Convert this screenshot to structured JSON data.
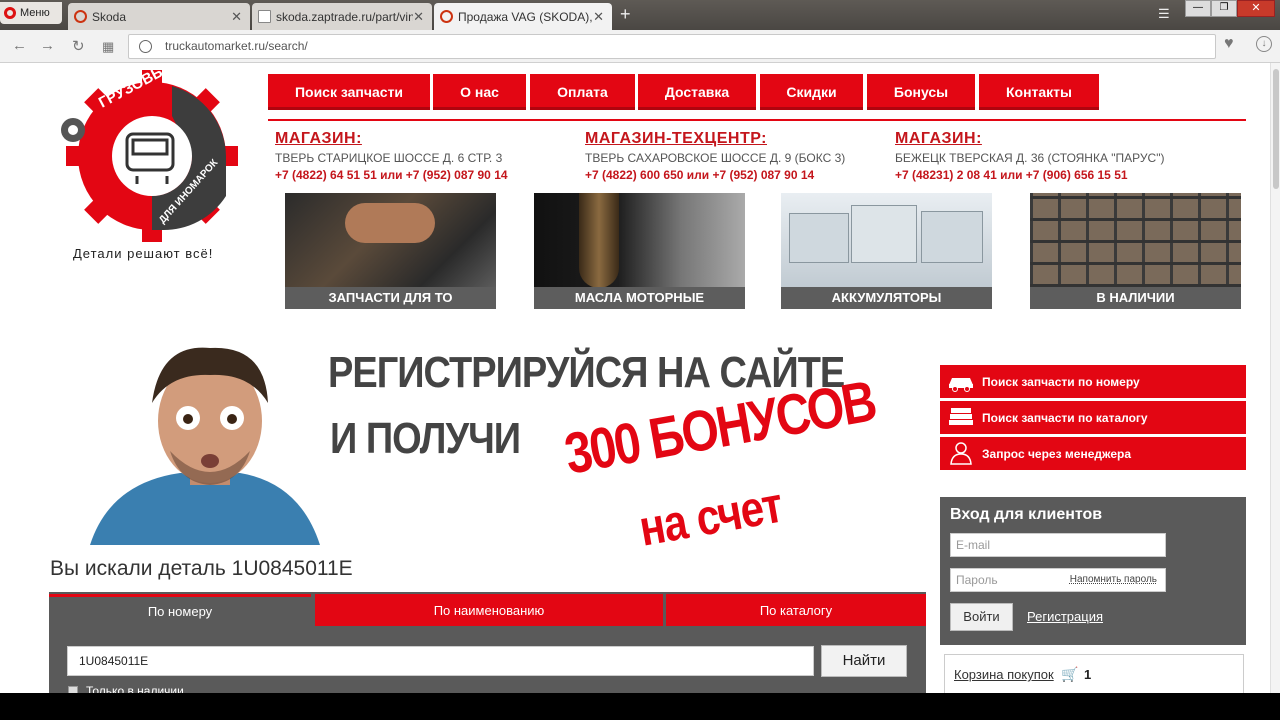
{
  "browser": {
    "menu_label": "Меню",
    "tabs": [
      {
        "title": "Skoda"
      },
      {
        "title": "skoda.zaptrade.ru/part/vin"
      },
      {
        "title": "Продажа VAG (SKODA), б"
      }
    ],
    "url": "truckautomarket.ru/search/"
  },
  "logo": {
    "arc_text": "ГРУЗОВЫЕ ЗАПЧАСТИ",
    "sub_text": "ДЛЯ ИНОМАРОК",
    "tagline": "Детали решают всё!"
  },
  "nav": {
    "items": [
      {
        "label": "Поиск запчасти"
      },
      {
        "label": "О нас"
      },
      {
        "label": "Оплата"
      },
      {
        "label": "Доставка"
      },
      {
        "label": "Скидки"
      },
      {
        "label": "Бонусы"
      },
      {
        "label": "Контакты"
      }
    ]
  },
  "stores": [
    {
      "title": "МАГАЗИН:",
      "address": "ТВЕРЬ СТАРИЦКОЕ ШОССЕ Д. 6 СТР. 3",
      "phone": "+7 (4822) 64 51 51 или +7 (952) 087 90 14"
    },
    {
      "title": "МАГАЗИН-ТЕХЦЕНТР:",
      "address": "ТВЕРЬ САХАРОВСКОЕ ШОССЕ Д. 9 (БОКС 3)",
      "phone": "+7 (4822) 600 650 или +7 (952) 087 90 14"
    },
    {
      "title": "МАГАЗИН:",
      "address": "БЕЖЕЦК ТВЕРСКАЯ Д. 36 (СТОЯНКА \"ПАРУС\")",
      "phone": "+7 (48231) 2 08 41 или +7 (906) 656 15 51"
    }
  ],
  "categories": [
    {
      "label": "ЗАПЧАСТИ ДЛЯ ТО"
    },
    {
      "label": "МАСЛА МОТОРНЫЕ"
    },
    {
      "label": "АККУМУЛЯТОРЫ"
    },
    {
      "label": "В НАЛИЧИИ"
    }
  ],
  "banner": {
    "line1": "РЕГИСТРИРУЙСЯ НА САЙТЕ",
    "line2": "И ПОЛУЧИ",
    "bonus1": "300 БОНУСОВ",
    "bonus2": "на счет"
  },
  "sidebar": {
    "buttons": [
      {
        "label": "Поиск запчасти по номеру",
        "icon": "car-icon"
      },
      {
        "label": "Поиск запчасти по каталогу",
        "icon": "books-icon"
      },
      {
        "label": "Запрос через менеджера",
        "icon": "manager-icon"
      }
    ],
    "login": {
      "title": "Вход для клиентов",
      "email_placeholder": "E-mail",
      "password_placeholder": "Пароль",
      "remind": "Напомнить пароль",
      "submit": "Войти",
      "register": "Регистрация"
    },
    "cart": {
      "label": "Корзина покупок",
      "count": "1"
    }
  },
  "search": {
    "heading": "Вы искали деталь 1U0845011E",
    "tabs": [
      {
        "label": "По номеру"
      },
      {
        "label": "По наименованию"
      },
      {
        "label": "По каталогу"
      }
    ],
    "value": "1U0845011E",
    "button": "Найти",
    "in_stock": "Только в наличии"
  },
  "colors": {
    "brand_red": "#e30613",
    "dark_panel": "#5a5a5a"
  }
}
